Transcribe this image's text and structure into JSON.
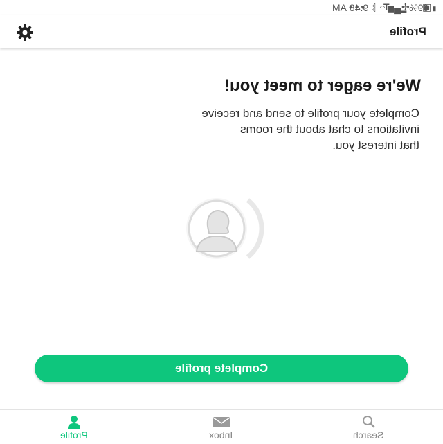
{
  "status_bar": {
    "time": "9:48 AM",
    "battery": "69%",
    "icons": [
      "battery-icon",
      "signal-icon",
      "wifi-icon",
      "bluetooth-icon",
      "more-dots-icon",
      "text-icon",
      "pinwheel-icon",
      "image-icon"
    ]
  },
  "header": {
    "title": "Profile",
    "settings_icon": "gear-icon"
  },
  "main": {
    "headline": "We're eager to meet you!",
    "description_lines": [
      "Complete your profile to send and receive",
      "invitations to chat about the rooms",
      "that interest you."
    ],
    "avatar_icon": "avatar-placeholder-icon",
    "cta_label": "Complete profile"
  },
  "bottom_nav": {
    "items": [
      {
        "label": "Profile",
        "icon": "person-icon",
        "active": true
      },
      {
        "label": "Inbox",
        "icon": "envelope-icon",
        "active": false
      },
      {
        "label": "Search",
        "icon": "search-icon",
        "active": false
      }
    ]
  },
  "colors": {
    "accent": "#0ec67d",
    "text": "#1b1b1b",
    "muted": "#888888"
  }
}
